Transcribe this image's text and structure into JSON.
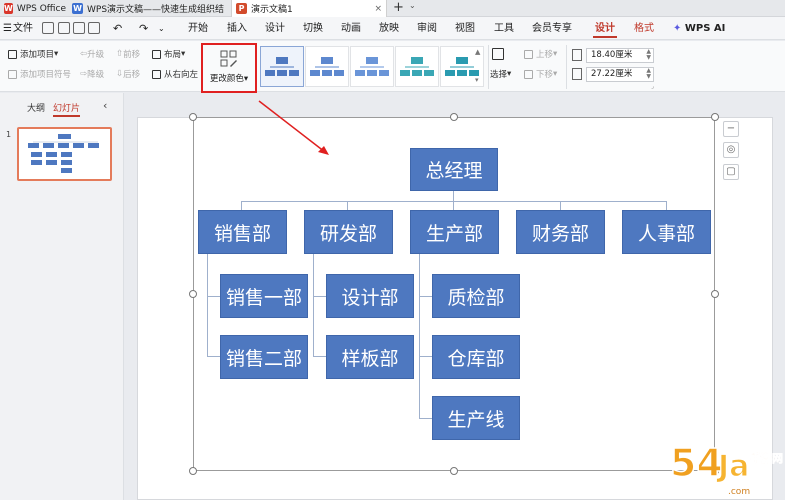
{
  "titlebar": {
    "tabs": [
      {
        "label": "WPS Office",
        "icon": "wps-logo-icon"
      },
      {
        "label": "WPS演示文稿——快速生成组织结",
        "icon": "wps-writer-icon"
      },
      {
        "label": "演示文稿1",
        "icon": "ppt-icon"
      }
    ],
    "new_tab": "+",
    "new_tab_menu": "⌄",
    "close_glyph": "×"
  },
  "menubar": {
    "file": "文件",
    "items": [
      "开始",
      "插入",
      "设计",
      "切换",
      "动画",
      "放映",
      "审阅",
      "视图",
      "工具",
      "会员专享",
      "设计",
      "格式"
    ],
    "ai": "WPS AI"
  },
  "ribbon": {
    "add_item": "添加项目",
    "add_assistant": "添加项目符号",
    "upgrade": "升级",
    "downgrade": "降级",
    "move_forward": "前移",
    "move_back": "后移",
    "layout": "布局",
    "right_to_left": "从右向左",
    "change_color": "更改颜色",
    "select": "选择",
    "move_up": "上移",
    "move_down": "下移",
    "height": "18.40厘米",
    "width": "27.22厘米"
  },
  "leftpanel": {
    "tab_outline": "大纲",
    "tab_slides": "幻灯片",
    "collapse": "‹",
    "slide_number": "1"
  },
  "org": {
    "root": "总经理",
    "departments": [
      "销售部",
      "研发部",
      "生产部",
      "财务部",
      "人事部"
    ],
    "sales_children": [
      "销售一部",
      "销售二部"
    ],
    "rd_children": [
      "设计部",
      "样板部"
    ],
    "prod_children": [
      "质检部",
      "仓库部",
      "生产线"
    ]
  },
  "sideicons": [
    "−",
    "◎",
    "▢"
  ],
  "colors": {
    "node": "#4e78c0",
    "accent_red": "#c0392b",
    "highlight_red": "#e02020"
  }
}
